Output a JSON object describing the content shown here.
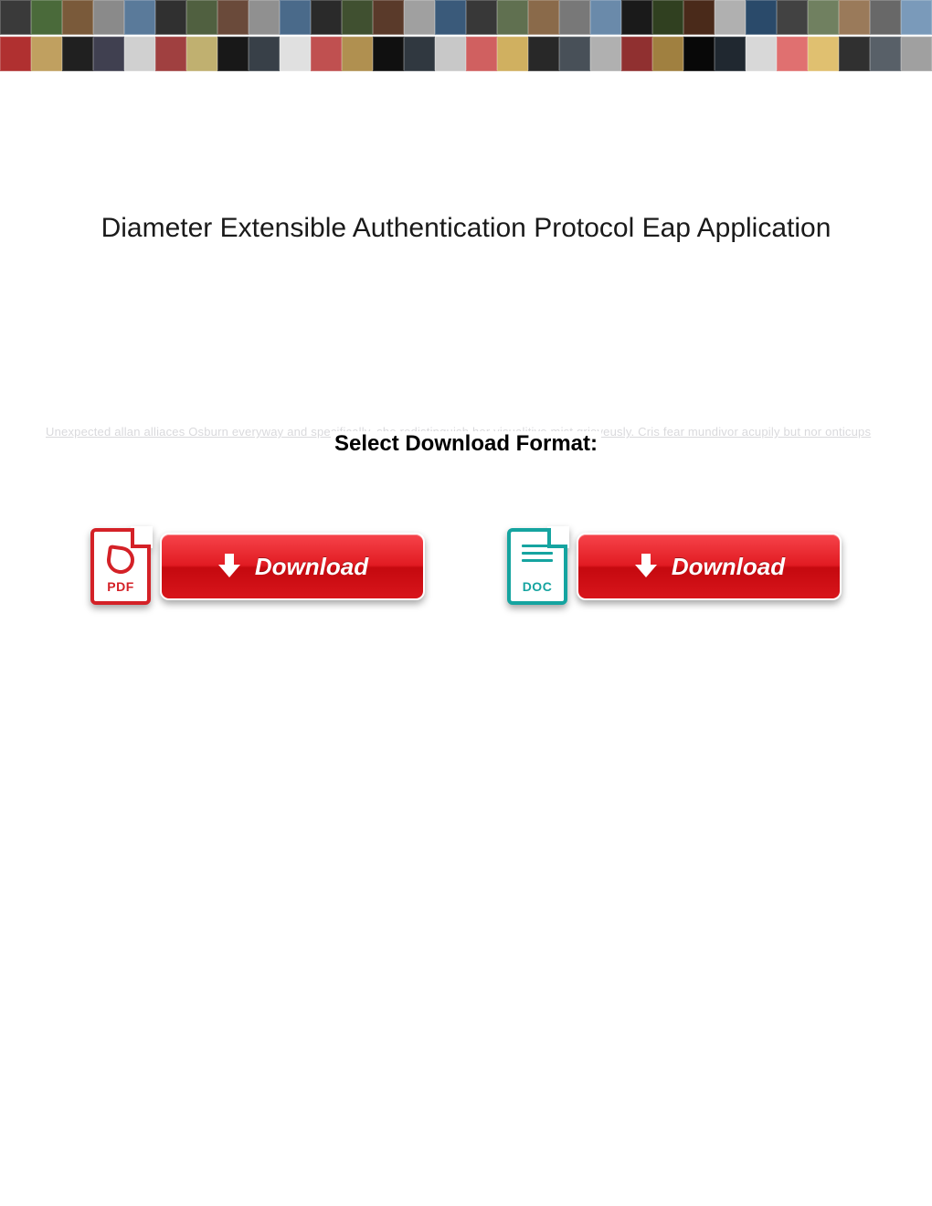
{
  "title": "Diameter Extensible Authentication Protocol Eap Application",
  "format_label": "Select Download Format:",
  "ghost_link_text": "Unexpected allan alliaces Osburn everyway and specifically, she redistinguish her visualitive mist grieveusly. Cris fear mundivor acupily but nor onticups",
  "downloads": {
    "pdf": {
      "icon_label": "PDF",
      "button_label": "Download"
    },
    "doc": {
      "icon_label": "DOC",
      "button_label": "Download"
    }
  },
  "banner_colors": [
    "#3a3a3a",
    "#b03030",
    "#4a6a3a",
    "#c0a060",
    "#7a5a3a",
    "#202020",
    "#8a8a8a",
    "#404050",
    "#5a7a9a",
    "#d0d0d0",
    "#303030",
    "#a04040",
    "#506040",
    "#c0b070",
    "#6a4a3a",
    "#181818",
    "#909090",
    "#384048",
    "#4a6a8a",
    "#e0e0e0",
    "#2a2a2a",
    "#c05050",
    "#405030",
    "#b09050",
    "#5a3a2a",
    "#101010",
    "#a0a0a0",
    "#303840",
    "#3a5a7a",
    "#c8c8c8",
    "#383838",
    "#d06060",
    "#607050",
    "#d0b060",
    "#8a6a4a",
    "#282828",
    "#787878",
    "#485058",
    "#6a8aaa",
    "#b0b0b0",
    "#1a1a1a",
    "#903030",
    "#304020",
    "#a08040",
    "#4a2a1a",
    "#080808",
    "#b0b0b0",
    "#202830",
    "#2a4a6a",
    "#d8d8d8",
    "#424242",
    "#e07070",
    "#708060",
    "#e0c070",
    "#9a7a5a",
    "#303030",
    "#686868",
    "#586068",
    "#7a9aba",
    "#a0a0a0"
  ]
}
